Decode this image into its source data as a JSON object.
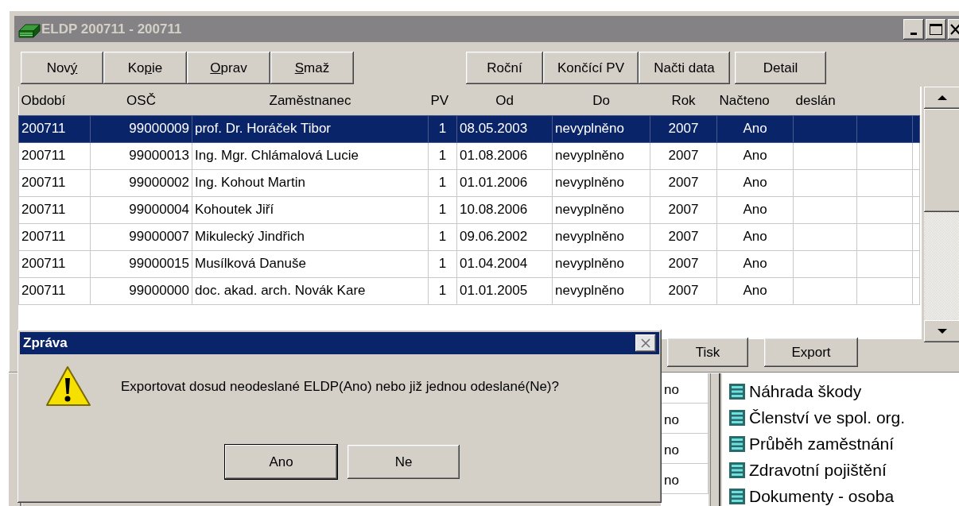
{
  "window": {
    "title": "ELDP 200711 - 200711"
  },
  "toolbar_left": [
    {
      "label_parts": [
        {
          "text": "Nov",
          "underlined": false
        },
        {
          "text": "ý",
          "underlined": true
        }
      ]
    },
    {
      "label_parts": [
        {
          "text": "Ko",
          "underlined": false
        },
        {
          "text": "p",
          "underlined": true
        },
        {
          "text": "ie",
          "underlined": false
        }
      ]
    },
    {
      "label_parts": [
        {
          "text": "O",
          "underlined": true
        },
        {
          "text": "prav",
          "underlined": false
        }
      ]
    },
    {
      "label_parts": [
        {
          "text": "S",
          "underlined": true
        },
        {
          "text": "maž",
          "underlined": false
        }
      ]
    }
  ],
  "toolbar_right": [
    {
      "label": "Roční"
    },
    {
      "label": "Končící PV"
    },
    {
      "label": "Načti data"
    },
    {
      "label": "Detail"
    }
  ],
  "table": {
    "columns": [
      "Období",
      "OSČ",
      "Zaměstnanec",
      "PV",
      "Od",
      "Do",
      "Rok",
      "Načteno",
      "deslán"
    ],
    "rows": [
      {
        "selected": true,
        "cells": [
          "200711",
          "99000009",
          "prof. Dr. Horáček Tibor",
          "1",
          "08.05.2003",
          "nevyplněno",
          "2007",
          "Ano"
        ]
      },
      {
        "selected": false,
        "cells": [
          "200711",
          "99000013",
          "Ing. Mgr. Chlámalová Lucie",
          "1",
          "01.08.2006",
          "nevyplněno",
          "2007",
          "Ano"
        ]
      },
      {
        "selected": false,
        "cells": [
          "200711",
          "99000002",
          "Ing. Kohout Martin",
          "1",
          "01.01.2006",
          "nevyplněno",
          "2007",
          "Ano"
        ]
      },
      {
        "selected": false,
        "cells": [
          "200711",
          "99000004",
          " Kohoutek Jiří",
          "1",
          "10.08.2006",
          "nevyplněno",
          "2007",
          "Ano"
        ]
      },
      {
        "selected": false,
        "cells": [
          "200711",
          "99000007",
          " Mikulecký Jindřich",
          "1",
          "09.06.2002",
          "nevyplněno",
          "2007",
          "Ano"
        ]
      },
      {
        "selected": false,
        "cells": [
          "200711",
          "99000015",
          " Musílková Danuše",
          "1",
          "01.04.2004",
          "nevyplněno",
          "2007",
          "Ano"
        ]
      },
      {
        "selected": false,
        "cells": [
          "200711",
          "99000000",
          "doc. akad. arch. Novák Kare",
          "1",
          "01.01.2005",
          "nevyplněno",
          "2007",
          "Ano"
        ]
      }
    ]
  },
  "bottom_buttons": [
    "Tisk",
    "Export"
  ],
  "background_window": {
    "column_cells": [
      "no",
      "no",
      "no",
      "no"
    ],
    "sidebar_items": [
      "Náhrada škody",
      "Členství ve spol. org.",
      "Průběh zaměstnání",
      "Zdravotní pojištění",
      "Dokumenty - osoba"
    ]
  },
  "dialog": {
    "title": "Zpráva",
    "message": "Exportovat dosud neodeslané ELDP(Ano) nebo již jednou odeslané(Ne)?",
    "buttons": [
      {
        "label": "Ano",
        "default": true
      },
      {
        "label": "Ne",
        "default": false
      }
    ]
  }
}
